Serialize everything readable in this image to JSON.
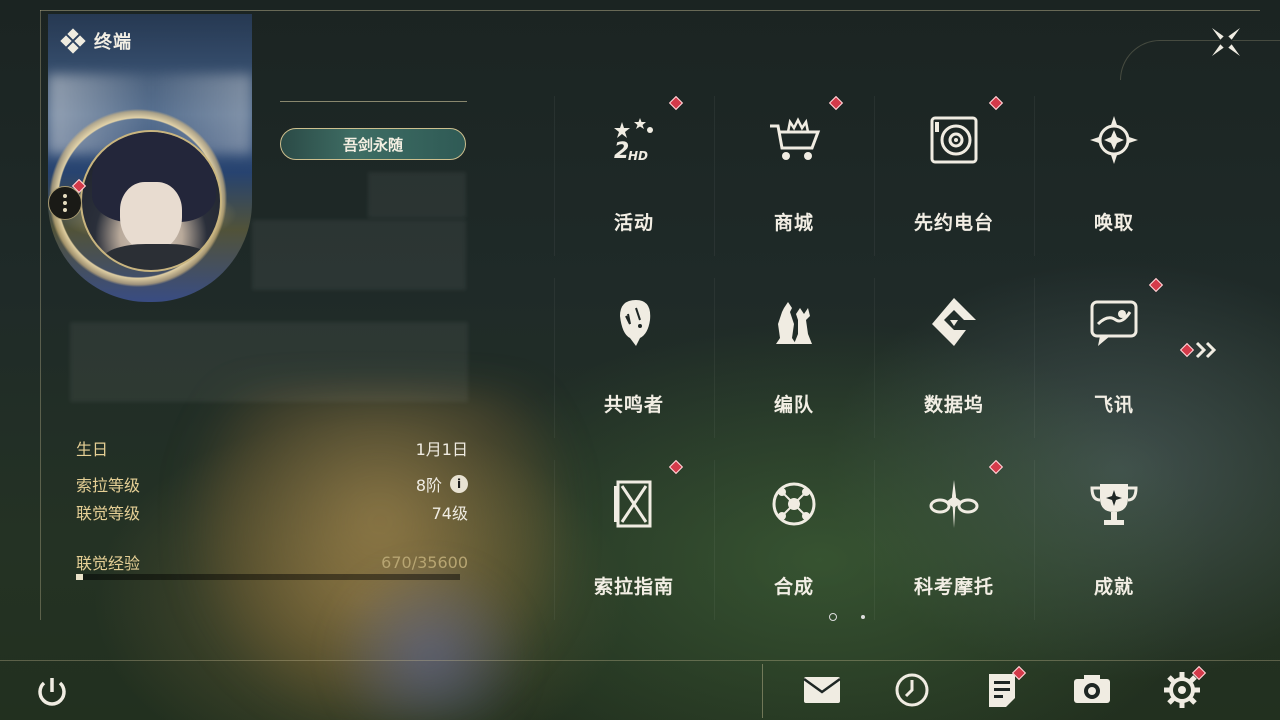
{
  "header": {
    "title": "终端"
  },
  "profile": {
    "title_badge": "吾剑永随",
    "stats": [
      {
        "label": "生日",
        "value": "1月1日"
      },
      {
        "label": "索拉等级",
        "value": "8阶"
      },
      {
        "label": "联觉等级",
        "value": "74级"
      }
    ],
    "exp_label": "联觉经验",
    "exp_value": "670/35600",
    "exp_progress": 0.0188
  },
  "grid": [
    {
      "label": "活动",
      "icon": "events-icon",
      "alert": true
    },
    {
      "label": "商城",
      "icon": "shop-icon",
      "alert": true
    },
    {
      "label": "先约电台",
      "icon": "radio-icon",
      "alert": true
    },
    {
      "label": "唤取",
      "icon": "convene-icon",
      "alert": false
    },
    {
      "label": "共鸣者",
      "icon": "resonator-icon",
      "alert": false
    },
    {
      "label": "编队",
      "icon": "team-icon",
      "alert": false
    },
    {
      "label": "数据坞",
      "icon": "data-bank-icon",
      "alert": false
    },
    {
      "label": "飞讯",
      "icon": "chat-icon",
      "alert": true
    },
    {
      "label": "索拉指南",
      "icon": "guide-icon",
      "alert": true
    },
    {
      "label": "合成",
      "icon": "synthesis-icon",
      "alert": false
    },
    {
      "label": "科考摩托",
      "icon": "motorcycle-icon",
      "alert": true
    },
    {
      "label": "成就",
      "icon": "trophy-icon",
      "alert": false
    }
  ],
  "pager": {
    "pages": 2,
    "current": 1
  },
  "bottom_bar": [
    {
      "name": "mail-icon",
      "alert": false
    },
    {
      "name": "clock-icon",
      "alert": false
    },
    {
      "name": "notice-icon",
      "alert": true
    },
    {
      "name": "camera-icon",
      "alert": false
    },
    {
      "name": "settings-icon",
      "alert": true
    }
  ],
  "colors": {
    "accent_gold": "#e5cf95",
    "alert_red": "#d43a4a",
    "text_light": "#f2eee4"
  }
}
